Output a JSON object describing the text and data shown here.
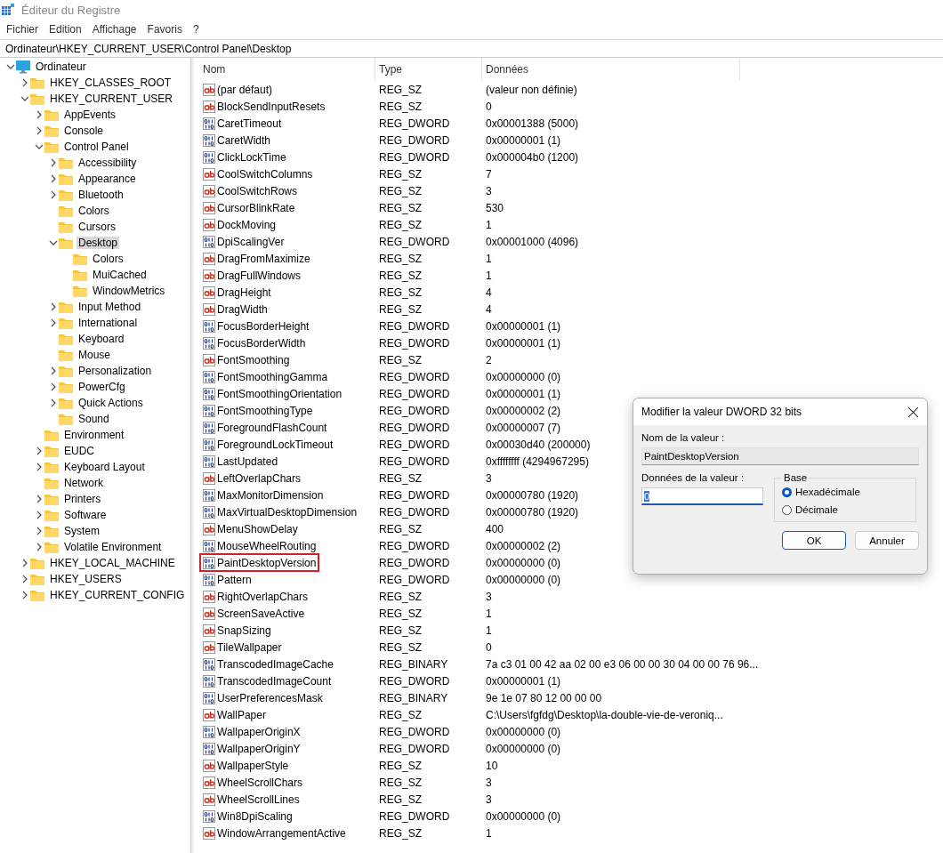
{
  "window": {
    "title": "Éditeur du Registre"
  },
  "menu": [
    "Fichier",
    "Edition",
    "Affichage",
    "Favoris",
    "?"
  ],
  "address": "Ordinateur\\HKEY_CURRENT_USER\\Control Panel\\Desktop",
  "tree": [
    {
      "label": "Ordinateur",
      "kind": "computer",
      "expanded": true,
      "selected": false,
      "children": [
        {
          "label": "HKEY_CLASSES_ROOT",
          "kind": "branch",
          "expanded": false,
          "selected": false
        },
        {
          "label": "HKEY_CURRENT_USER",
          "kind": "branch",
          "expanded": true,
          "selected": false,
          "children": [
            {
              "label": "AppEvents",
              "kind": "branch",
              "expanded": false,
              "selected": false
            },
            {
              "label": "Console",
              "kind": "branch",
              "expanded": false,
              "selected": false
            },
            {
              "label": "Control Panel",
              "kind": "branch",
              "expanded": true,
              "selected": false,
              "children": [
                {
                  "label": "Accessibility",
                  "kind": "branch",
                  "expanded": false,
                  "selected": false
                },
                {
                  "label": "Appearance",
                  "kind": "branch",
                  "expanded": false,
                  "selected": false
                },
                {
                  "label": "Bluetooth",
                  "kind": "branch",
                  "expanded": false,
                  "selected": false
                },
                {
                  "label": "Colors",
                  "kind": "leaf",
                  "selected": false
                },
                {
                  "label": "Cursors",
                  "kind": "leaf",
                  "selected": false
                },
                {
                  "label": "Desktop",
                  "kind": "branch",
                  "expanded": true,
                  "selected": true,
                  "children": [
                    {
                      "label": "Colors",
                      "kind": "leaf",
                      "selected": false
                    },
                    {
                      "label": "MuiCached",
                      "kind": "leaf",
                      "selected": false
                    },
                    {
                      "label": "WindowMetrics",
                      "kind": "leaf",
                      "selected": false
                    }
                  ]
                },
                {
                  "label": "Input Method",
                  "kind": "branch",
                  "expanded": false,
                  "selected": false
                },
                {
                  "label": "International",
                  "kind": "branch",
                  "expanded": false,
                  "selected": false
                },
                {
                  "label": "Keyboard",
                  "kind": "leaf",
                  "selected": false
                },
                {
                  "label": "Mouse",
                  "kind": "leaf",
                  "selected": false
                },
                {
                  "label": "Personalization",
                  "kind": "branch",
                  "expanded": false,
                  "selected": false
                },
                {
                  "label": "PowerCfg",
                  "kind": "branch",
                  "expanded": false,
                  "selected": false
                },
                {
                  "label": "Quick Actions",
                  "kind": "branch",
                  "expanded": false,
                  "selected": false
                },
                {
                  "label": "Sound",
                  "kind": "leaf",
                  "selected": false
                }
              ]
            },
            {
              "label": "Environment",
              "kind": "leaf",
              "selected": false
            },
            {
              "label": "EUDC",
              "kind": "branch",
              "expanded": false,
              "selected": false
            },
            {
              "label": "Keyboard Layout",
              "kind": "branch",
              "expanded": false,
              "selected": false
            },
            {
              "label": "Network",
              "kind": "leaf",
              "selected": false
            },
            {
              "label": "Printers",
              "kind": "branch",
              "expanded": false,
              "selected": false
            },
            {
              "label": "Software",
              "kind": "branch",
              "expanded": false,
              "selected": false
            },
            {
              "label": "System",
              "kind": "branch",
              "expanded": false,
              "selected": false
            },
            {
              "label": "Volatile Environment",
              "kind": "branch",
              "expanded": false,
              "selected": false
            }
          ]
        },
        {
          "label": "HKEY_LOCAL_MACHINE",
          "kind": "branch",
          "expanded": false,
          "selected": false
        },
        {
          "label": "HKEY_USERS",
          "kind": "branch",
          "expanded": false,
          "selected": false
        },
        {
          "label": "HKEY_CURRENT_CONFIG",
          "kind": "branch",
          "expanded": false,
          "selected": false
        }
      ]
    }
  ],
  "list": {
    "columns": [
      "Nom",
      "Type",
      "Données"
    ],
    "rows": [
      {
        "kind": "string",
        "name": "(par défaut)",
        "type": "REG_SZ",
        "data": "(valeur non définie)",
        "selected": false
      },
      {
        "kind": "string",
        "name": "BlockSendInputResets",
        "type": "REG_SZ",
        "data": "0",
        "selected": false
      },
      {
        "kind": "binary",
        "name": "CaretTimeout",
        "type": "REG_DWORD",
        "data": "0x00001388 (5000)",
        "selected": false
      },
      {
        "kind": "binary",
        "name": "CaretWidth",
        "type": "REG_DWORD",
        "data": "0x00000001 (1)",
        "selected": false
      },
      {
        "kind": "binary",
        "name": "ClickLockTime",
        "type": "REG_DWORD",
        "data": "0x000004b0 (1200)",
        "selected": false
      },
      {
        "kind": "string",
        "name": "CoolSwitchColumns",
        "type": "REG_SZ",
        "data": "7",
        "selected": false
      },
      {
        "kind": "string",
        "name": "CoolSwitchRows",
        "type": "REG_SZ",
        "data": "3",
        "selected": false
      },
      {
        "kind": "string",
        "name": "CursorBlinkRate",
        "type": "REG_SZ",
        "data": "530",
        "selected": false
      },
      {
        "kind": "string",
        "name": "DockMoving",
        "type": "REG_SZ",
        "data": "1",
        "selected": false
      },
      {
        "kind": "binary",
        "name": "DpiScalingVer",
        "type": "REG_DWORD",
        "data": "0x00001000 (4096)",
        "selected": false
      },
      {
        "kind": "string",
        "name": "DragFromMaximize",
        "type": "REG_SZ",
        "data": "1",
        "selected": false
      },
      {
        "kind": "string",
        "name": "DragFullWindows",
        "type": "REG_SZ",
        "data": "1",
        "selected": false
      },
      {
        "kind": "string",
        "name": "DragHeight",
        "type": "REG_SZ",
        "data": "4",
        "selected": false
      },
      {
        "kind": "string",
        "name": "DragWidth",
        "type": "REG_SZ",
        "data": "4",
        "selected": false
      },
      {
        "kind": "binary",
        "name": "FocusBorderHeight",
        "type": "REG_DWORD",
        "data": "0x00000001 (1)",
        "selected": false
      },
      {
        "kind": "binary",
        "name": "FocusBorderWidth",
        "type": "REG_DWORD",
        "data": "0x00000001 (1)",
        "selected": false
      },
      {
        "kind": "string",
        "name": "FontSmoothing",
        "type": "REG_SZ",
        "data": "2",
        "selected": false
      },
      {
        "kind": "binary",
        "name": "FontSmoothingGamma",
        "type": "REG_DWORD",
        "data": "0x00000000 (0)",
        "selected": false
      },
      {
        "kind": "binary",
        "name": "FontSmoothingOrientation",
        "type": "REG_DWORD",
        "data": "0x00000001 (1)",
        "selected": false
      },
      {
        "kind": "binary",
        "name": "FontSmoothingType",
        "type": "REG_DWORD",
        "data": "0x00000002 (2)",
        "selected": false
      },
      {
        "kind": "binary",
        "name": "ForegroundFlashCount",
        "type": "REG_DWORD",
        "data": "0x00000007 (7)",
        "selected": false
      },
      {
        "kind": "binary",
        "name": "ForegroundLockTimeout",
        "type": "REG_DWORD",
        "data": "0x00030d40 (200000)",
        "selected": false
      },
      {
        "kind": "binary",
        "name": "LastUpdated",
        "type": "REG_DWORD",
        "data": "0xffffffff (4294967295)",
        "selected": false
      },
      {
        "kind": "string",
        "name": "LeftOverlapChars",
        "type": "REG_SZ",
        "data": "3",
        "selected": false
      },
      {
        "kind": "binary",
        "name": "MaxMonitorDimension",
        "type": "REG_DWORD",
        "data": "0x00000780 (1920)",
        "selected": false
      },
      {
        "kind": "binary",
        "name": "MaxVirtualDesktopDimension",
        "type": "REG_DWORD",
        "data": "0x00000780 (1920)",
        "selected": false
      },
      {
        "kind": "string",
        "name": "MenuShowDelay",
        "type": "REG_SZ",
        "data": "400",
        "selected": false
      },
      {
        "kind": "binary",
        "name": "MouseWheelRouting",
        "type": "REG_DWORD",
        "data": "0x00000002 (2)",
        "selected": false
      },
      {
        "kind": "binary",
        "name": "PaintDesktopVersion",
        "type": "REG_DWORD",
        "data": "0x00000000 (0)",
        "selected": true
      },
      {
        "kind": "binary",
        "name": "Pattern",
        "type": "REG_DWORD",
        "data": "0x00000000 (0)",
        "selected": false
      },
      {
        "kind": "string",
        "name": "RightOverlapChars",
        "type": "REG_SZ",
        "data": "3",
        "selected": false
      },
      {
        "kind": "string",
        "name": "ScreenSaveActive",
        "type": "REG_SZ",
        "data": "1",
        "selected": false
      },
      {
        "kind": "string",
        "name": "SnapSizing",
        "type": "REG_SZ",
        "data": "1",
        "selected": false
      },
      {
        "kind": "string",
        "name": "TileWallpaper",
        "type": "REG_SZ",
        "data": "0",
        "selected": false
      },
      {
        "kind": "binary",
        "name": "TranscodedImageCache",
        "type": "REG_BINARY",
        "data": "7a c3 01 00 42 aa 02 00 e3 06 00 00 30 04 00 00 76 96...",
        "selected": false
      },
      {
        "kind": "binary",
        "name": "TranscodedImageCount",
        "type": "REG_DWORD",
        "data": "0x00000001 (1)",
        "selected": false
      },
      {
        "kind": "binary",
        "name": "UserPreferencesMask",
        "type": "REG_BINARY",
        "data": "9e 1e 07 80 12 00 00 00",
        "selected": false
      },
      {
        "kind": "string",
        "name": "WallPaper",
        "type": "REG_SZ",
        "data": "C:\\Users\\fgfdg\\Desktop\\la-double-vie-de-veroniq...",
        "selected": false
      },
      {
        "kind": "binary",
        "name": "WallpaperOriginX",
        "type": "REG_DWORD",
        "data": "0x00000000 (0)",
        "selected": false
      },
      {
        "kind": "binary",
        "name": "WallpaperOriginY",
        "type": "REG_DWORD",
        "data": "0x00000000 (0)",
        "selected": false
      },
      {
        "kind": "string",
        "name": "WallpaperStyle",
        "type": "REG_SZ",
        "data": "10",
        "selected": false
      },
      {
        "kind": "string",
        "name": "WheelScrollChars",
        "type": "REG_SZ",
        "data": "3",
        "selected": false
      },
      {
        "kind": "string",
        "name": "WheelScrollLines",
        "type": "REG_SZ",
        "data": "3",
        "selected": false
      },
      {
        "kind": "binary",
        "name": "Win8DpiScaling",
        "type": "REG_DWORD",
        "data": "0x00000000 (0)",
        "selected": false
      },
      {
        "kind": "string",
        "name": "WindowArrangementActive",
        "type": "REG_SZ",
        "data": "1",
        "selected": false
      }
    ]
  },
  "dialog": {
    "title": "Modifier la valeur DWORD 32 bits",
    "value_name_label": "Nom de la valeur :",
    "value_name": "PaintDesktopVersion",
    "value_data_label": "Données de la valeur :",
    "value_data": "0",
    "value_data_text_selected": true,
    "base": {
      "label": "Base",
      "options": [
        {
          "label": "Hexadécimale",
          "selected": true
        },
        {
          "label": "Décimale",
          "selected": false
        }
      ]
    },
    "buttons": [
      {
        "label": "OK",
        "default": true
      },
      {
        "label": "Annuler",
        "default": false
      }
    ]
  }
}
